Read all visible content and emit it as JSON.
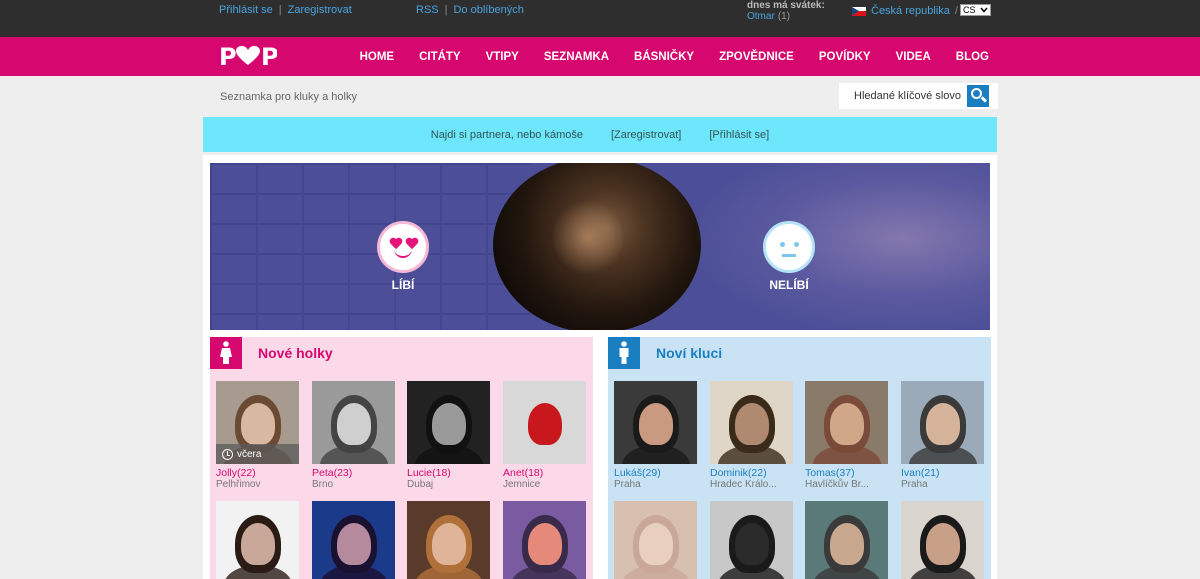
{
  "topbar": {
    "login": "Přihlásit se",
    "sep": "|",
    "register": "Zaregistrovat",
    "rss": "RSS",
    "favorites": "Do oblíbených",
    "nameday_title": "dnes má svátek:",
    "nameday_name": "Otmar",
    "nameday_count": "(1)",
    "country": "Česká republika",
    "country_sep": "/",
    "lang": "CS"
  },
  "nav": {
    "logo": "POP",
    "items": [
      "HOME",
      "CITÁTY",
      "VTIPY",
      "SEZNAMKA",
      "BÁSNIČKY",
      "ZPOVĚDNICE",
      "POVÍDKY",
      "VIDEA",
      "BLOG"
    ]
  },
  "search": {
    "tagline": "Seznamka pro kluky a holky",
    "placeholder": "Hledané klíčové slovo"
  },
  "infobar": {
    "text": "Najdi si partnera, nebo kámoše",
    "register": "[Zaregistrovat]",
    "login": "[Přihlásit se]"
  },
  "hero": {
    "like": "LÍBÍ",
    "dislike": "NELÍBÍ"
  },
  "girls": {
    "title": "Nové holky",
    "cards": [
      {
        "name": "Jolly(22)",
        "city": "Pelhřimov",
        "badge": "včera",
        "bg": "#a79a8e",
        "face": "#d8b8a0",
        "hair": "#6a4a32"
      },
      {
        "name": "Peta(23)",
        "city": "Brno",
        "bg": "#9a9a9a",
        "face": "#cfcfcf",
        "hair": "#444444"
      },
      {
        "name": "Lucie(18)",
        "city": "Dubaj",
        "bg": "#222222",
        "face": "#9a9a9a",
        "hair": "#111111"
      },
      {
        "name": "Anet(18)",
        "city": "Jemnice",
        "bg": "#d8d8d8",
        "face": "#c8181e",
        "hair": "#d8d8d8"
      },
      {
        "name": "",
        "city": "",
        "bg": "#f2f2f2",
        "face": "#c9a89a",
        "hair": "#2a1c14"
      },
      {
        "name": "",
        "city": "",
        "bg": "#1b3a8a",
        "face": "#b48a9c",
        "hair": "#1a1030"
      },
      {
        "name": "",
        "city": "",
        "bg": "#5a3a2a",
        "face": "#e0b498",
        "hair": "#b0703a"
      },
      {
        "name": "",
        "city": "",
        "bg": "#7a5aa0",
        "face": "#e58a7a",
        "hair": "#3a2a4a"
      }
    ]
  },
  "boys": {
    "title": "Noví kluci",
    "cards": [
      {
        "name": "Lukáš(29)",
        "city": "Praha",
        "bg": "#3a3a3a",
        "face": "#c99a80",
        "hair": "#1a1a1a"
      },
      {
        "name": "Dominik(22)",
        "city": "Hradec Králo...",
        "bg": "#e0d6c8",
        "face": "#b08a70",
        "hair": "#3a2a1a"
      },
      {
        "name": "Tomas(37)",
        "city": "Havlíčkův Br...",
        "bg": "#8a7a6a",
        "face": "#d0a888",
        "hair": "#7a4a3a"
      },
      {
        "name": "Ivan(21)",
        "city": "Praha",
        "bg": "#9aaab8",
        "face": "#d6b49c",
        "hair": "#3a3a3a"
      },
      {
        "name": "",
        "city": "",
        "bg": "#d8c0b0",
        "face": "#e8cfc0",
        "hair": "#caa898"
      },
      {
        "name": "",
        "city": "",
        "bg": "#c8c8c8",
        "face": "#2a2a2a",
        "hair": "#1a1a1a"
      },
      {
        "name": "",
        "city": "",
        "bg": "#5a7a7a",
        "face": "#c9a890",
        "hair": "#3a3a3a"
      },
      {
        "name": "",
        "city": "",
        "bg": "#dad4ce",
        "face": "#c8a088",
        "hair": "#1a1a1a"
      }
    ]
  }
}
